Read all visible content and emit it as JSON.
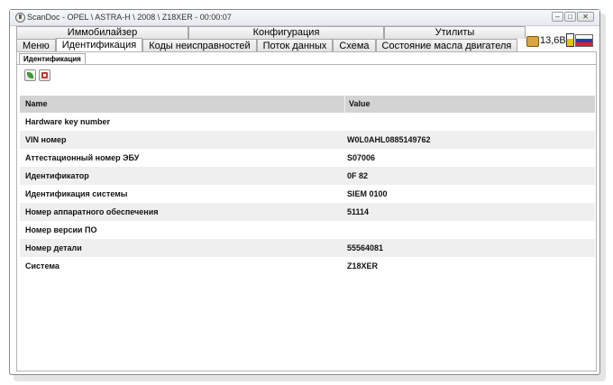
{
  "window": {
    "title": "ScanDoc - OPEL \\ ASTRA-H \\ 2008 \\ Z18XER - 00:00:07",
    "minimize_glyph": "–",
    "maximize_glyph": "□",
    "close_glyph": "✕"
  },
  "top_tabs": [
    "Иммобилайзер",
    "Конфигурация",
    "Утилиты"
  ],
  "sub_tabs": [
    {
      "label": "Меню",
      "active": false
    },
    {
      "label": "Идентификация",
      "active": true
    },
    {
      "label": "Коды неисправностей",
      "active": false
    },
    {
      "label": "Поток данных",
      "active": false
    },
    {
      "label": "Схема",
      "active": false
    },
    {
      "label": "Состояние масла двигателя",
      "active": false
    }
  ],
  "status": {
    "voltage": "13,6В",
    "icons": [
      "phone-icon",
      "battery-icon",
      "russia-flag-icon"
    ]
  },
  "panel": {
    "inner_tab": "Идентификация",
    "toolbar_icons": [
      "refresh-icon",
      "save-icon"
    ]
  },
  "table": {
    "headers": {
      "name": "Name",
      "value": "Value"
    },
    "rows": [
      {
        "name": "Hardware key number",
        "value": ""
      },
      {
        "name": "VIN номер",
        "value": "W0L0AHL0885149762"
      },
      {
        "name": "Аттестационный номер ЭБУ",
        "value": "S07006"
      },
      {
        "name": "Идентификатор",
        "value": "0F 82"
      },
      {
        "name": "Идентификация системы",
        "value": "SIEM 0100"
      },
      {
        "name": "Номер аппаратного обеспечения",
        "value": "51114"
      },
      {
        "name": "Номер версии ПО",
        "value": ""
      },
      {
        "name": "Номер детали",
        "value": "55564081"
      },
      {
        "name": "Система",
        "value": "Z18XER"
      }
    ]
  }
}
